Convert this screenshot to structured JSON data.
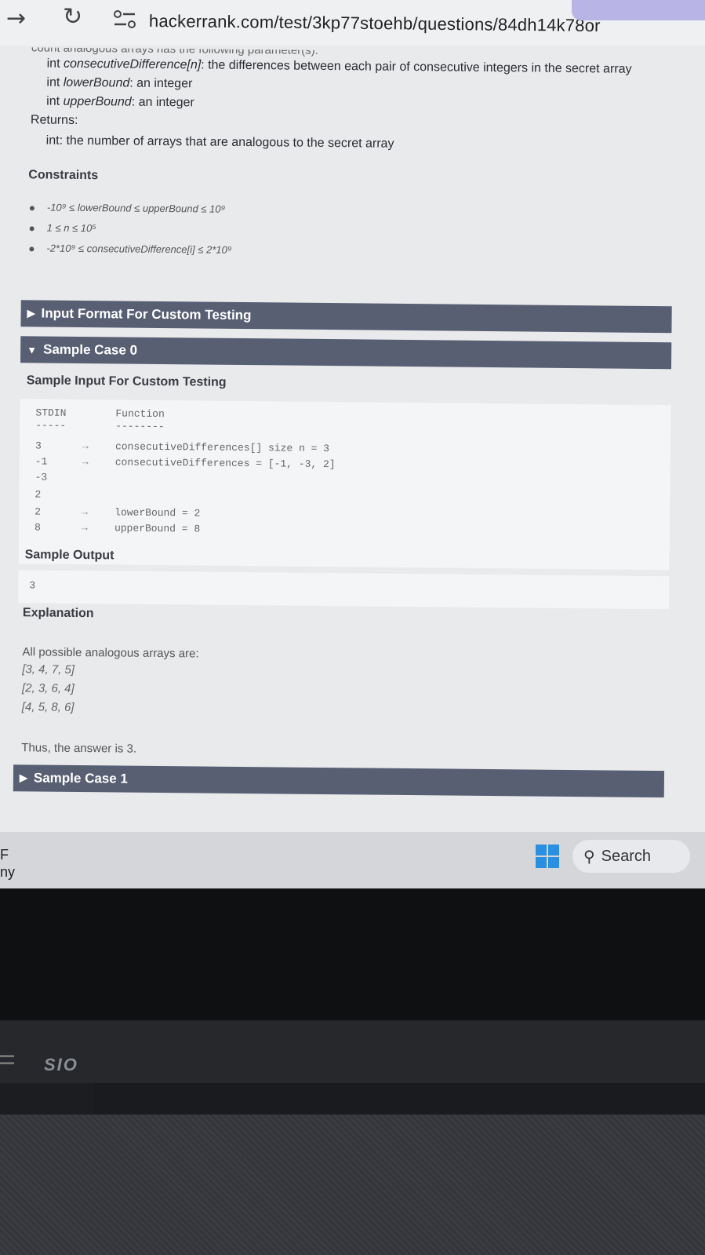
{
  "browser": {
    "url": "hackerrank.com/test/3kp77stoehb/questions/84dh14k78or"
  },
  "problem": {
    "cut_line": "count analogous arrays has the following parameter(s):",
    "params": [
      {
        "type": "int",
        "name": "consecutiveDifference[n]",
        "desc": ": the differences between each pair of consecutive integers in the secret array"
      },
      {
        "type": "int",
        "name": "lowerBound",
        "desc": ": an integer"
      },
      {
        "type": "int",
        "name": "upperBound",
        "desc": ": an integer"
      }
    ],
    "returns_label": "Returns:",
    "returns_text": "int: the number of arrays that are analogous to the secret array",
    "constraints_title": "Constraints",
    "constraints": [
      "-10⁹ ≤ lowerBound ≤ upperBound ≤ 10⁹",
      "1 ≤ n ≤ 10⁵",
      "-2*10⁹ ≤ consecutiveDifference[i] ≤ 2*10⁹"
    ]
  },
  "sections": {
    "input_format": "Input Format For Custom Testing",
    "sample_case_0": "Sample Case 0",
    "sample_case_1": "Sample Case 1"
  },
  "sample": {
    "input_title": "Sample Input For Custom Testing",
    "col_stdin": "STDIN",
    "col_function": "Function",
    "dash_stdin": "-----",
    "dash_function": "--------",
    "rows": [
      {
        "stdin": "3",
        "arrow": "→",
        "func": "consecutiveDifferences[] size n = 3"
      },
      {
        "stdin": "-1",
        "arrow": "→",
        "func": "consecutiveDifferences = [-1, -3, 2]"
      },
      {
        "stdin": "-3",
        "arrow": "",
        "func": ""
      },
      {
        "stdin": "2",
        "arrow": "",
        "func": ""
      },
      {
        "stdin": "2",
        "arrow": "→",
        "func": "lowerBound = 2"
      },
      {
        "stdin": "8",
        "arrow": "→",
        "func": "upperBound = 8"
      }
    ],
    "output_title": "Sample Output",
    "output_value": "3",
    "explanation_title": "Explanation",
    "explanation_intro": "All possible analogous arrays are:",
    "arrays": [
      "[3, 4, 7, 5]",
      "[2, 3, 6, 4]",
      "[4, 5, 8, 6]"
    ],
    "conclusion": "Thus, the answer is 3."
  },
  "taskbar": {
    "left_text_1": "F",
    "left_text_2": "ny",
    "search_label": "Search"
  },
  "laptop": {
    "brand": "SIO"
  },
  "colors": {
    "section_bar": "#585f73",
    "windows_blue": "#2a8fe0",
    "tab_accent": "#b9b4e6"
  }
}
